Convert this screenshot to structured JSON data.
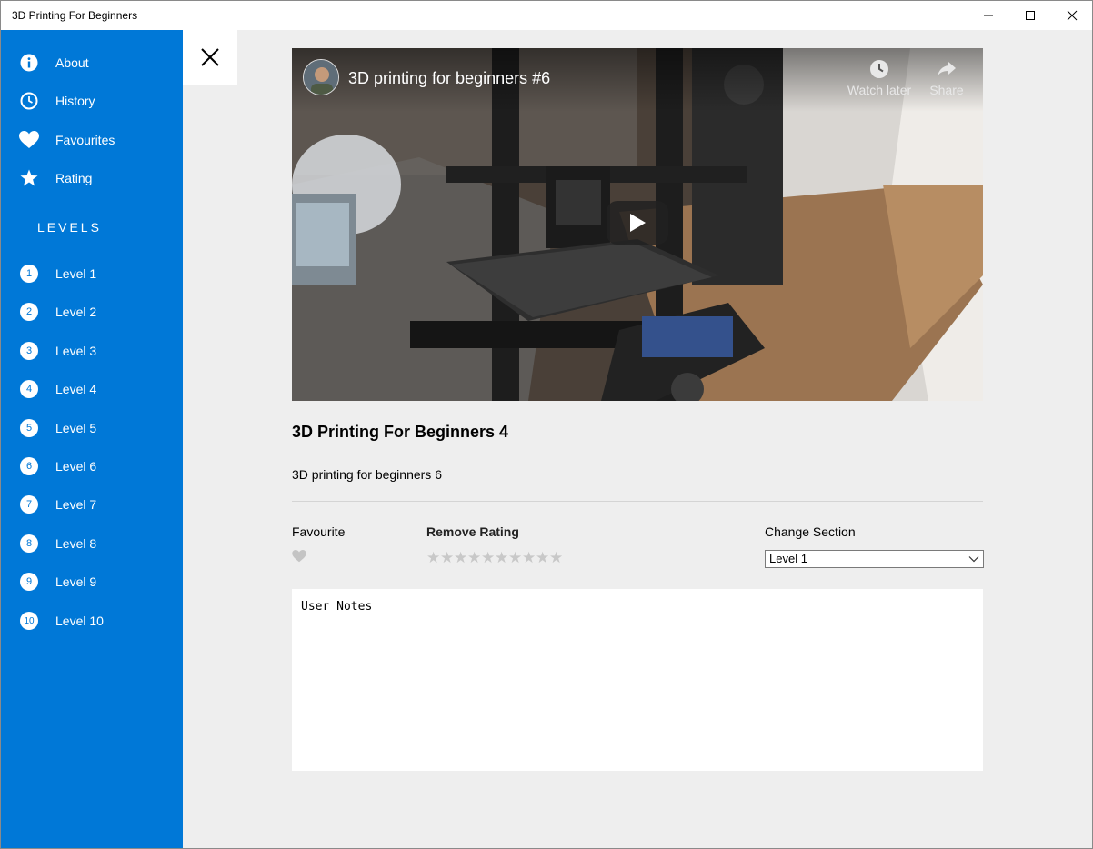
{
  "window": {
    "title": "3D Printing For Beginners"
  },
  "sidebar": {
    "items": [
      {
        "label": "About",
        "icon": "info-icon"
      },
      {
        "label": "History",
        "icon": "clock-icon"
      },
      {
        "label": "Favourites",
        "icon": "heart-icon"
      },
      {
        "label": "Rating",
        "icon": "star-icon"
      }
    ],
    "levels_heading": "LEVELS",
    "levels": [
      {
        "num": "1",
        "label": "Level 1"
      },
      {
        "num": "2",
        "label": "Level 2"
      },
      {
        "num": "3",
        "label": "Level 3"
      },
      {
        "num": "4",
        "label": "Level 4"
      },
      {
        "num": "5",
        "label": "Level 5"
      },
      {
        "num": "6",
        "label": "Level 6"
      },
      {
        "num": "7",
        "label": "Level 7"
      },
      {
        "num": "8",
        "label": "Level 8"
      },
      {
        "num": "9",
        "label": "Level 9"
      },
      {
        "num": "10",
        "label": "Level 10"
      }
    ],
    "accent_color": "#0078d7"
  },
  "video": {
    "title": "3D printing for beginners #6",
    "watch_later_label": "Watch later",
    "share_label": "Share"
  },
  "content": {
    "title": "3D Printing For Beginners 4",
    "description": "3D printing for beginners 6",
    "favourite_label": "Favourite",
    "rating_label": "Remove Rating",
    "rating_max": 10,
    "rating_value": 0,
    "section_label": "Change Section",
    "section_selected": "Level 1",
    "notes_placeholder": "User Notes"
  }
}
